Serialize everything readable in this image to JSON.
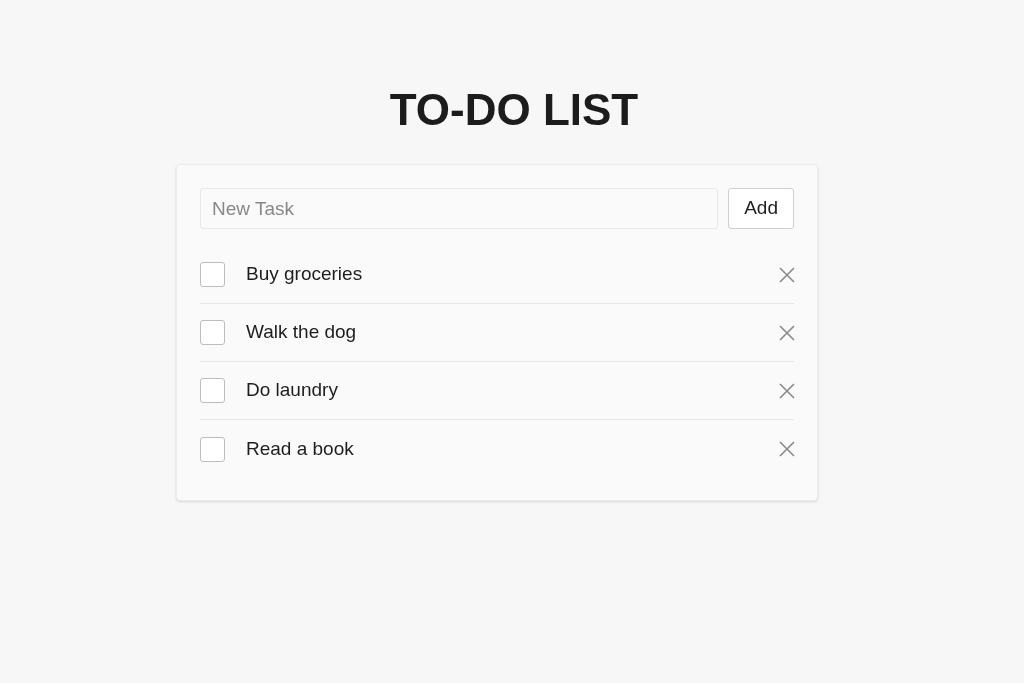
{
  "title": "TO-DO LIST",
  "new_task": {
    "placeholder": "New Task"
  },
  "add_button": "Add",
  "tasks": [
    {
      "label": "Buy groceries",
      "checked": false
    },
    {
      "label": "Walk the dog",
      "checked": false
    },
    {
      "label": "Do laundry",
      "checked": false
    },
    {
      "label": "Read a book",
      "checked": false
    }
  ]
}
